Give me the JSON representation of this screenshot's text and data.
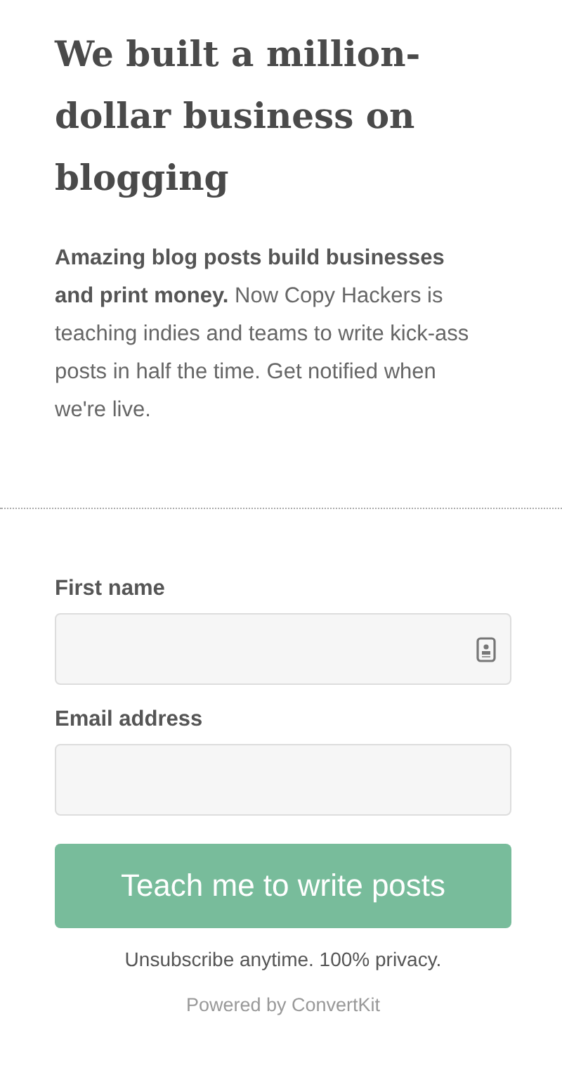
{
  "headline": "We built a million-dollar business on blogging",
  "intro": "**Amazing blog posts build businesses and print money.** Now Copy Hackers is teaching indies and teams to write kick-ass posts in half the time. Get notified when we're live.",
  "form": {
    "fields": [
      {
        "label": "First name",
        "autofill_icon": true
      },
      {
        "label": "Email address",
        "autofill_icon": false
      }
    ],
    "submit": "Teach me to write posts",
    "note": "Unsubscribe anytime. 100% privacy.",
    "powered_by": "Powered by ConvertKit"
  }
}
